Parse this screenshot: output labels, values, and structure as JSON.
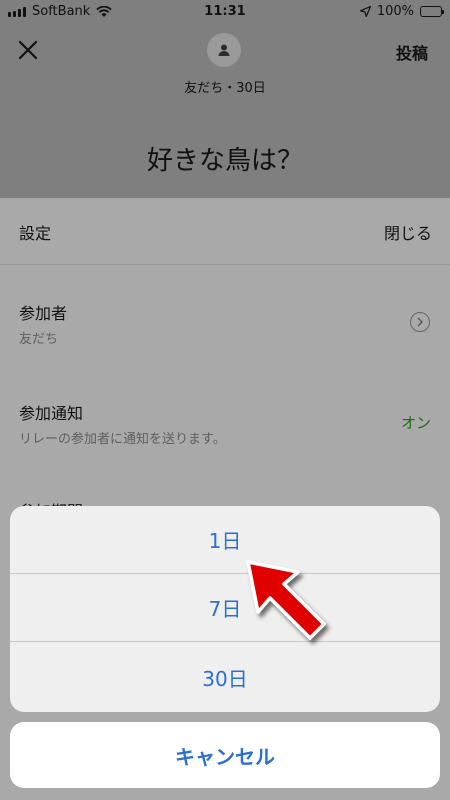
{
  "status_bar": {
    "carrier": "SoftBank",
    "time": "11:31",
    "battery": "100%"
  },
  "header": {
    "post_label": "投稿",
    "subtitle": "友だち・30日",
    "question": "好きな鳥は？"
  },
  "settings": {
    "title": "設定",
    "close_label": "閉じる",
    "participants": {
      "title": "参加者",
      "value": "友だち"
    },
    "notification": {
      "title": "参加通知",
      "description": "リレーの参加者に通知を送ります。",
      "state": "オン"
    },
    "period_title": "参加期間"
  },
  "period_options": [
    "1日",
    "7日",
    "30日"
  ],
  "cancel_label": "キャンセル",
  "colors": {
    "accent": "#2b6fd3",
    "toggle_on": "#1b6e10",
    "arrow": "#e00000"
  }
}
